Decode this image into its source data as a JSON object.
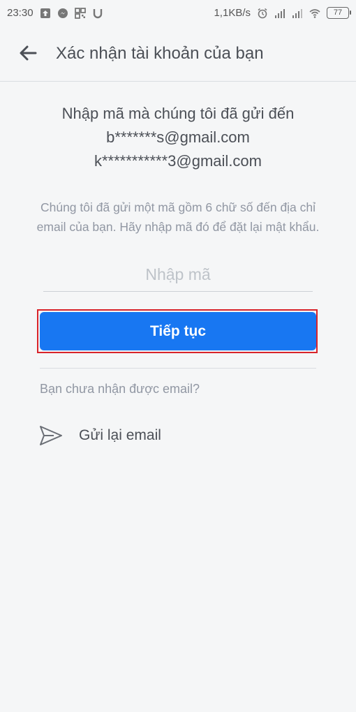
{
  "status_bar": {
    "time": "23:30",
    "net_speed": "1,1KB/s",
    "battery": "77"
  },
  "header": {
    "title": "Xác nhận tài khoản của bạn"
  },
  "intro": {
    "line1": "Nhập mã mà chúng tôi đã gửi đến",
    "email1": "b*******s@gmail.com",
    "email2": "k***********3@gmail.com"
  },
  "hint": "Chúng tôi đã gửi một mã gồm 6 chữ số đến địa chỉ email của bạn. Hãy nhập mã đó để đặt lại mật khẩu.",
  "code_input": {
    "placeholder": "Nhập mã",
    "value": ""
  },
  "continue_button": {
    "label": "Tiếp tục"
  },
  "no_email_text": "Bạn chưa nhận được email?",
  "resend": {
    "label": "Gửi lại email"
  },
  "colors": {
    "primary": "#1877f2",
    "highlight": "#d8232a",
    "background": "#f5f6f7"
  }
}
